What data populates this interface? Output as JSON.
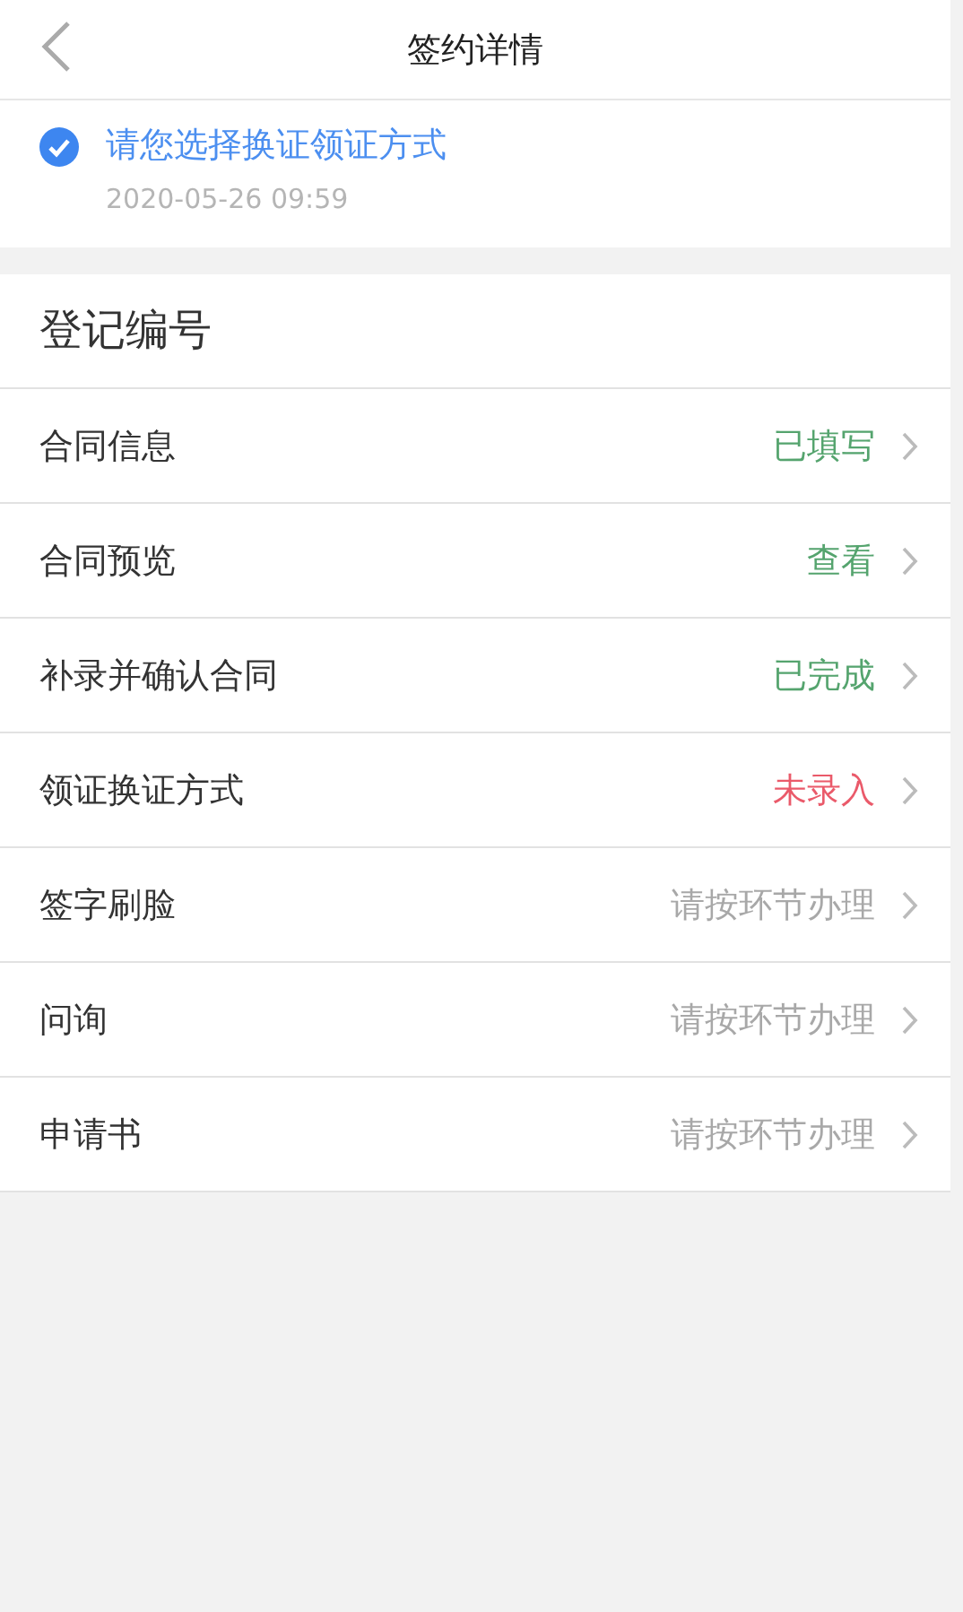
{
  "nav": {
    "title": "签约详情"
  },
  "notice": {
    "checked": true,
    "text": "请您选择换证领证方式",
    "time": "2020-05-26 09:59"
  },
  "section": {
    "title": "登记编号",
    "rows": [
      {
        "label": "合同信息",
        "status": "已填写",
        "kind": "done"
      },
      {
        "label": "合同预览",
        "status": "查看",
        "kind": "done"
      },
      {
        "label": "补录并确认合同",
        "status": "已完成",
        "kind": "done"
      },
      {
        "label": "领证换证方式",
        "status": "未录入",
        "kind": "missing"
      },
      {
        "label": "签字刷脸",
        "status": "请按环节办理",
        "kind": "pending"
      },
      {
        "label": "问询",
        "status": "请按环节办理",
        "kind": "pending"
      },
      {
        "label": "申请书",
        "status": "请按环节办理",
        "kind": "pending"
      }
    ]
  }
}
